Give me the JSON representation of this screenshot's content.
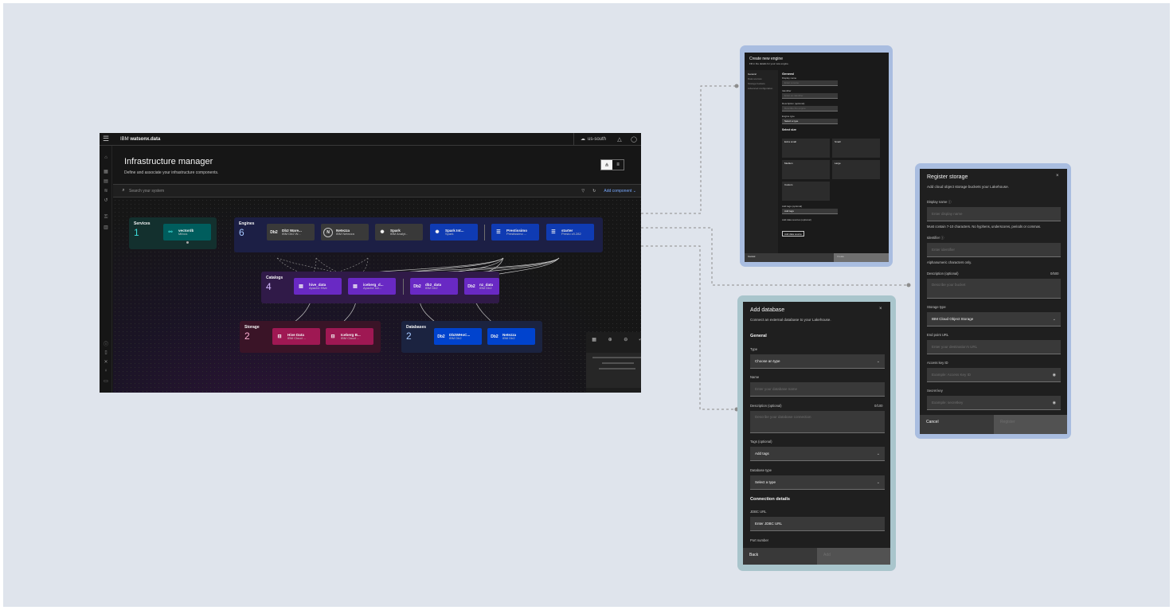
{
  "app": {
    "brand_prefix": "IBM",
    "brand_name": "watsonx.data",
    "region": "us-south",
    "title": "Infrastructure manager",
    "subtitle": "Define and associate your infrastructure components.",
    "search_placeholder": "Search your system",
    "add_component": "Add component",
    "icons": {
      "menu": "☰",
      "cloud": "☁",
      "bell": "🔔",
      "user": "◯",
      "search": "⌕",
      "filter": "▽",
      "refresh": "↻",
      "chevron": "⌄"
    }
  },
  "services": {
    "title": "Services",
    "count": "1",
    "nodes": [
      {
        "name": "vectordb",
        "sub": "Milvus"
      }
    ]
  },
  "engines": {
    "title": "Engines",
    "count": "6",
    "nodes": [
      {
        "name": "Db2 Ware...",
        "sub": "IBM Db2 W...",
        "icon": "Db2"
      },
      {
        "name": "Netezza",
        "sub": "IBM Netezza",
        "icon": "N"
      },
      {
        "name": "Spark",
        "sub": "IBM Analyt...",
        "icon": "✺"
      },
      {
        "name": "Spark Int...",
        "sub": "Spark",
        "icon": "✺"
      },
      {
        "name": "Prestissimo",
        "sub": "Prestissimo ...",
        "icon": "☰"
      },
      {
        "name": "starter",
        "sub": "Presto v0.282",
        "icon": "☰"
      }
    ]
  },
  "catalogs": {
    "title": "Catalogs",
    "count": "4",
    "nodes": [
      {
        "name": "hive_data",
        "sub": "Apache Hive",
        "icon": "▤"
      },
      {
        "name": "iceberg_d...",
        "sub": "Apache Ice...",
        "icon": "▤"
      },
      {
        "name": "db2_data",
        "sub": "IBM Db2",
        "icon": "Db2"
      },
      {
        "name": "nz_data",
        "sub": "IBM Db2",
        "icon": "Db2"
      }
    ]
  },
  "storage": {
    "title": "Storage",
    "count": "2",
    "nodes": [
      {
        "name": "Hive Data",
        "sub": "IBM Cloud ...",
        "icon": "⊟"
      },
      {
        "name": "Iceberg B...",
        "sub": "IBM Cloud ...",
        "icon": "⊟"
      }
    ]
  },
  "databases": {
    "title": "Databases",
    "count": "2",
    "nodes": [
      {
        "name": "Db2WHoC...",
        "sub": "IBM Db2",
        "icon": "Db2"
      },
      {
        "name": "Netezza",
        "sub": "IBM Db2",
        "icon": "Db2"
      }
    ]
  },
  "minimap_icons": [
    "▦",
    "⊕",
    "⊖",
    "⤢"
  ],
  "create_engine": {
    "title": "Create new engine",
    "subtitle": "Fill in the details for your new engine.",
    "nav": [
      "General",
      "Data sources",
      "Storage buckets",
      "Advanced configuration"
    ],
    "section": "General",
    "fields": [
      {
        "label": "Display name",
        "placeholder": "Enter a name"
      },
      {
        "label": "Identifier",
        "placeholder": "Enter an identifier"
      },
      {
        "label": "Description (optional)",
        "placeholder": "Describe the engine"
      },
      {
        "label": "Engine type",
        "value": "Select a type"
      }
    ],
    "size_title": "Select size",
    "sizes": [
      "Extra small",
      "Small",
      "Medium",
      "Large",
      "Custom"
    ],
    "tags_label": "Add tags (optional)",
    "tags_value": "Add tags",
    "sources_label": "Add data sources (optional)",
    "add_button": "Add data source",
    "footer": [
      "Cancel",
      "Create"
    ]
  },
  "register_storage": {
    "title": "Register storage",
    "subtitle": "Add cloud object storage buckets your Lakehouse.",
    "display_name_label": "Display name",
    "display_name_placeholder": "Enter display name",
    "display_name_help": "Must contain 7-10 characters. No hyphens, underscores, periods or commas.",
    "identifier_label": "Identifier",
    "identifier_placeholder": "Enter identifier",
    "identifier_help": "Alphanumeric characters only.",
    "description_label": "Description (optional)",
    "description_counter": "0/500",
    "description_placeholder": "Describe your bucket",
    "storage_type_label": "Storage type",
    "storage_type_value": "IBM Cloud Object Storage",
    "endpoint_label": "End point URL",
    "endpoint_placeholder": "Enter your destination's URL",
    "access_key_label": "Access key ID",
    "access_key_placeholder": "Example: Access Key ID",
    "secret_key_label": "Secret key",
    "secret_key_placeholder": "Example: secretkey",
    "cancel": "Cancel",
    "submit": "Register"
  },
  "add_database": {
    "title": "Add database",
    "subtitle": "Connect an external database to your Lakehouse.",
    "general": "General",
    "type_label": "Type",
    "type_value": "Choose an type",
    "name_label": "Name",
    "name_placeholder": "Enter your database name",
    "description_label": "Description (optional)",
    "description_counter": "0/100",
    "description_placeholder": "Describe your database connection",
    "tags_label": "Tags (optional)",
    "tags_value": "Add tags",
    "dbtype_label": "Database type",
    "dbtype_value": "Select a type",
    "connection": "Connection details",
    "jdbc_label": "JDBC URL",
    "jdbc_value": "Enter JDBC URL",
    "port_label": "Port number",
    "back": "Back",
    "next": "Add"
  },
  "colors": {
    "canvas": "#dfe4ec",
    "frame_blue": "#a9bde0",
    "frame_teal": "#a9c5cc",
    "services_group": "#13302e",
    "engines_group": "#1c1f45",
    "catalogs_group": "#301a48",
    "storage_group": "#3a1427",
    "databases_group": "#1b2340"
  }
}
